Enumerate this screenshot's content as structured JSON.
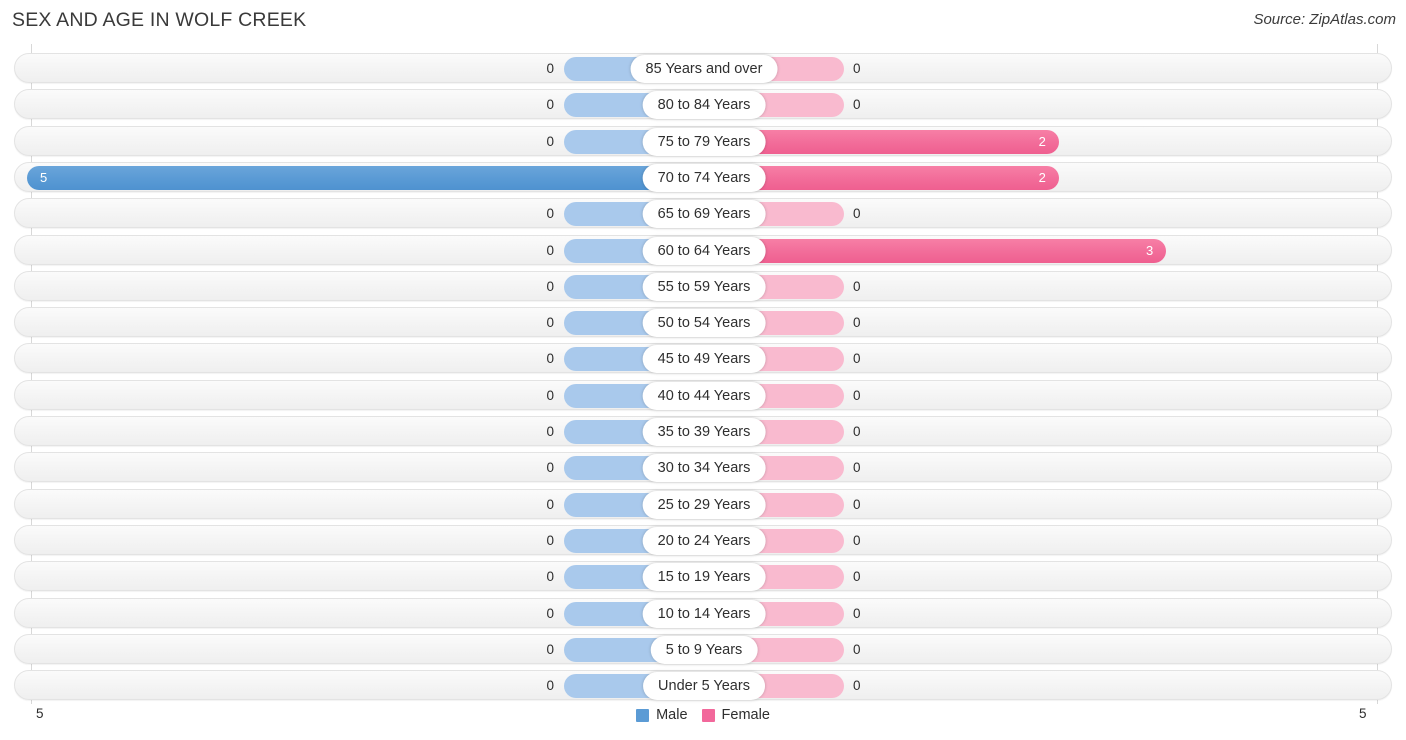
{
  "header": {
    "title": "SEX AND AGE IN WOLF CREEK",
    "source": "Source: ZipAtlas.com"
  },
  "legend": {
    "male_label": "Male",
    "female_label": "Female",
    "male_color": "#5b9bd5",
    "female_color": "#f2689b",
    "male_color_empty": "#a9c9ec",
    "female_color_empty": "#f9bacf"
  },
  "axis": {
    "left_tick": "5",
    "right_tick": "5",
    "max": 5
  },
  "chart_data": {
    "type": "bar",
    "title": "Sex and Age in Wolf Creek",
    "xlabel": "",
    "ylabel": "",
    "orientation": "horizontal",
    "layout": "population-pyramid",
    "xlim": [
      5,
      5
    ],
    "grid": true,
    "legend_position": "bottom-center",
    "categories": [
      "85 Years and over",
      "80 to 84 Years",
      "75 to 79 Years",
      "70 to 74 Years",
      "65 to 69 Years",
      "60 to 64 Years",
      "55 to 59 Years",
      "50 to 54 Years",
      "45 to 49 Years",
      "40 to 44 Years",
      "35 to 39 Years",
      "30 to 34 Years",
      "25 to 29 Years",
      "20 to 24 Years",
      "15 to 19 Years",
      "10 to 14 Years",
      "5 to 9 Years",
      "Under 5 Years"
    ],
    "series": [
      {
        "name": "Male",
        "side": "left",
        "values": [
          0,
          0,
          0,
          5,
          0,
          0,
          0,
          0,
          0,
          0,
          0,
          0,
          0,
          0,
          0,
          0,
          0,
          0
        ]
      },
      {
        "name": "Female",
        "side": "right",
        "values": [
          0,
          0,
          2,
          2,
          0,
          3,
          0,
          0,
          0,
          0,
          0,
          0,
          0,
          0,
          0,
          0,
          0,
          0
        ]
      }
    ]
  },
  "rows": [
    {
      "label": "85 Years and over",
      "male": "0",
      "female": "0"
    },
    {
      "label": "80 to 84 Years",
      "male": "0",
      "female": "0"
    },
    {
      "label": "75 to 79 Years",
      "male": "0",
      "female": "2"
    },
    {
      "label": "70 to 74 Years",
      "male": "5",
      "female": "2"
    },
    {
      "label": "65 to 69 Years",
      "male": "0",
      "female": "0"
    },
    {
      "label": "60 to 64 Years",
      "male": "0",
      "female": "3"
    },
    {
      "label": "55 to 59 Years",
      "male": "0",
      "female": "0"
    },
    {
      "label": "50 to 54 Years",
      "male": "0",
      "female": "0"
    },
    {
      "label": "45 to 49 Years",
      "male": "0",
      "female": "0"
    },
    {
      "label": "40 to 44 Years",
      "male": "0",
      "female": "0"
    },
    {
      "label": "35 to 39 Years",
      "male": "0",
      "female": "0"
    },
    {
      "label": "30 to 34 Years",
      "male": "0",
      "female": "0"
    },
    {
      "label": "25 to 29 Years",
      "male": "0",
      "female": "0"
    },
    {
      "label": "20 to 24 Years",
      "male": "0",
      "female": "0"
    },
    {
      "label": "15 to 19 Years",
      "male": "0",
      "female": "0"
    },
    {
      "label": "10 to 14 Years",
      "male": "0",
      "female": "0"
    },
    {
      "label": "5 to 9 Years",
      "male": "0",
      "female": "0"
    },
    {
      "label": "Under 5 Years",
      "male": "0",
      "female": "0"
    }
  ]
}
